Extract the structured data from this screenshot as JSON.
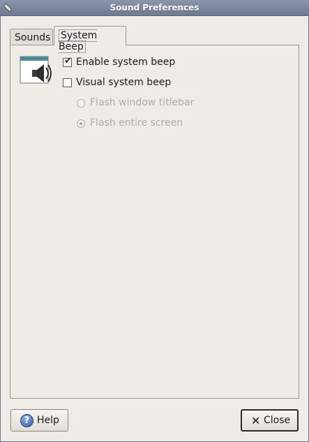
{
  "window": {
    "title": "Sound Preferences"
  },
  "tabs": [
    {
      "label": "Sounds",
      "selected": false
    },
    {
      "label": "System Beep",
      "selected": true
    }
  ],
  "beep": {
    "icon": "speaker-window-icon",
    "enable_label": "Enable system beep",
    "enable_checked": true,
    "visual_label": "Visual system beep",
    "visual_checked": false,
    "flash_titlebar_label": "Flash window titlebar",
    "flash_titlebar_selected": false,
    "flash_screen_label": "Flash entire screen",
    "flash_screen_selected": true
  },
  "buttons": {
    "help_label": "Help",
    "close_label": "Close"
  },
  "colors": {
    "titlebar": "#7a859c",
    "background": "#efebe7",
    "disabled_text": "#b0aba3"
  }
}
